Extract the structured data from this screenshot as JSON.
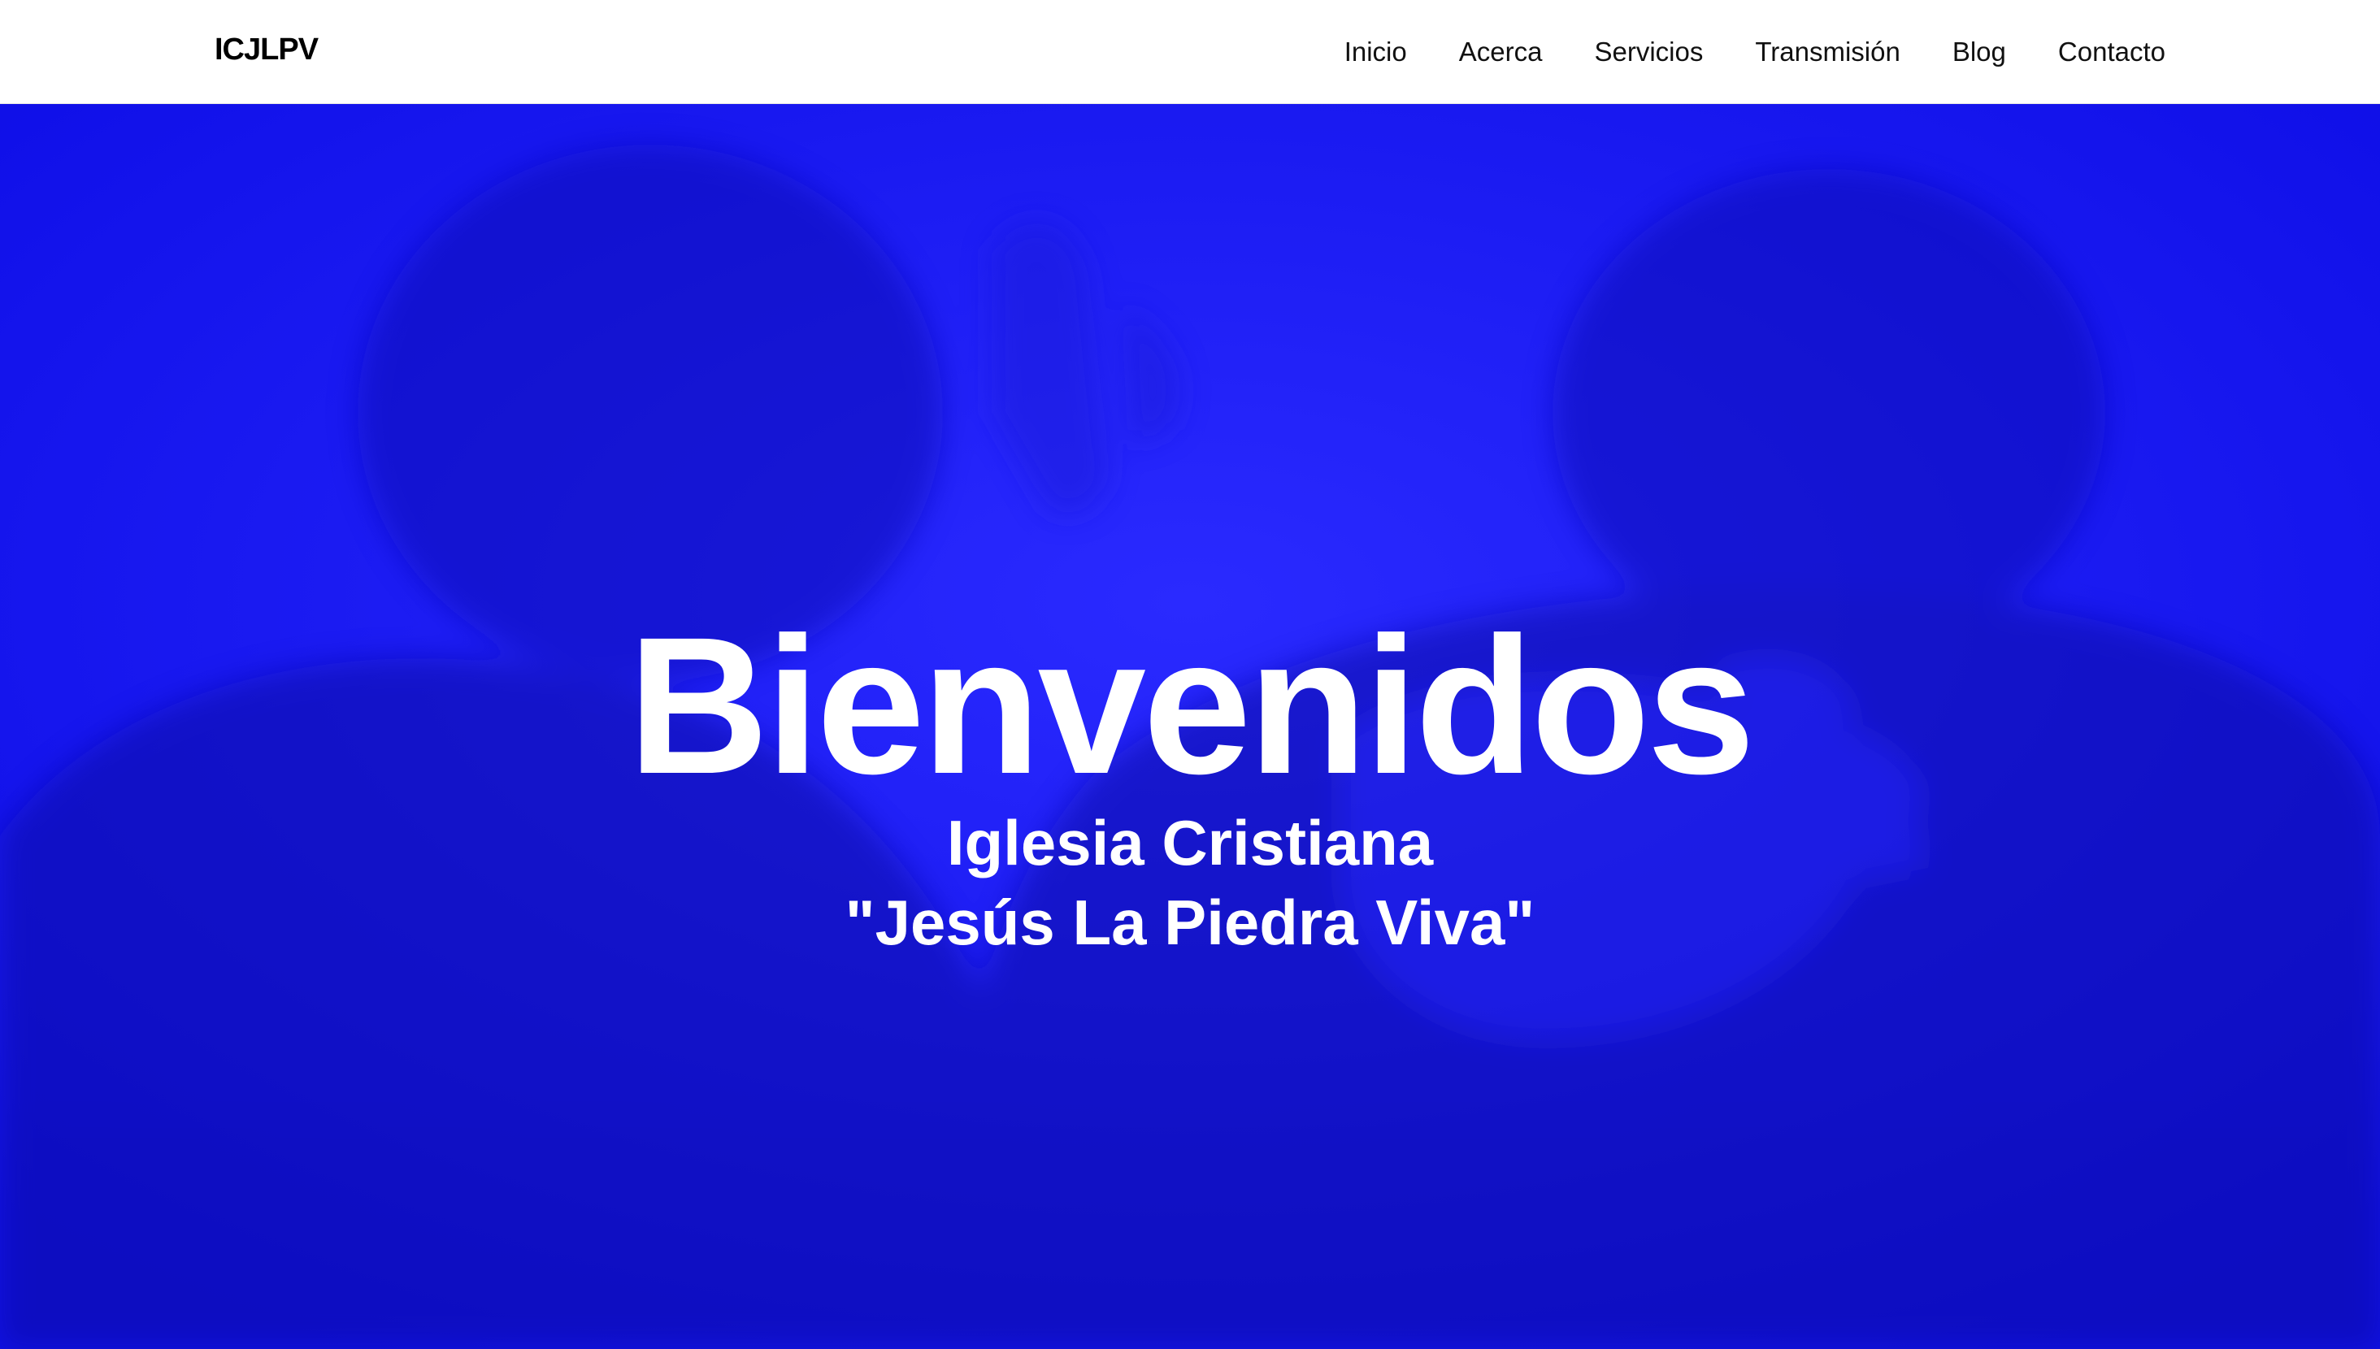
{
  "header": {
    "logo": "ICJLPV",
    "nav": [
      "Inicio",
      "Acerca",
      "Servicios",
      "Transmisión",
      "Blog",
      "Contacto"
    ]
  },
  "hero": {
    "title": "Bienvenidos",
    "subtitle_line1": "Iglesia Cristiana",
    "subtitle_line2": "\"Jesús La Piedra Viva\"",
    "background_image": "photo of two men praying, one with hand on the other's shoulder, blue overlay"
  },
  "colors": {
    "hero_overlay": "#1414f5",
    "header_bg": "#ffffff",
    "text_dark": "#111111",
    "text_light": "#ffffff"
  }
}
